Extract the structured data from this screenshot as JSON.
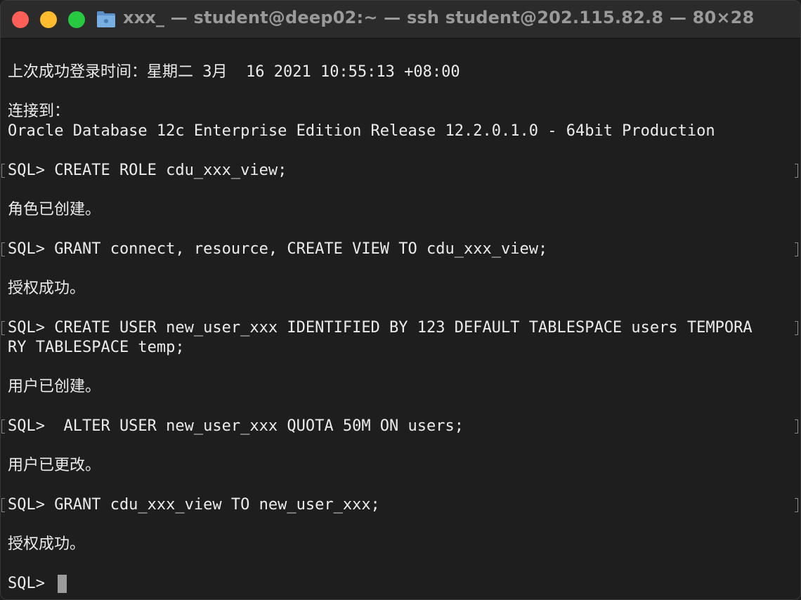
{
  "window": {
    "title": "xxx_ — student@deep02:~ — ssh student@202.115.82.8 — 80×28"
  },
  "terminal": {
    "lines": [
      "上次成功登录时间：星期二 3月  16 2021 10:55:13 +08:00",
      "连接到：",
      "Oracle Database 12c Enterprise Edition Release 12.2.0.1.0 - 64bit Production",
      "SQL> CREATE ROLE cdu_xxx_view;",
      "角色已创建。",
      "SQL> GRANT connect, resource, CREATE VIEW TO cdu_xxx_view;",
      "授权成功。",
      "SQL> CREATE USER new_user_xxx IDENTIFIED BY 123 DEFAULT TABLESPACE users TEMPORA",
      "RY TABLESPACE temp;",
      "用户已创建。",
      "SQL>  ALTER USER new_user_xxx QUOTA 50M ON users;",
      "用户已更改。",
      "SQL> GRANT cdu_xxx_view TO new_user_xxx;",
      "授权成功。",
      "SQL> "
    ]
  },
  "colors": {
    "background": "#1e1e1e",
    "text": "#ececec",
    "titlebar": "#2b2b2b",
    "close": "#ff5f57",
    "minimize": "#febc2e",
    "maximize": "#28c840"
  },
  "icons": {
    "folder": "folder-icon"
  }
}
